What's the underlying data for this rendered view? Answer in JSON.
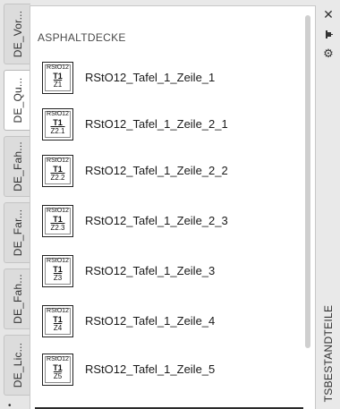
{
  "tabs": [
    {
      "label": "DE_Vor...",
      "active": false
    },
    {
      "label": "DE_Qu...",
      "active": true
    },
    {
      "label": "DE_Fah...",
      "active": false
    },
    {
      "label": "DE_Far...",
      "active": false
    },
    {
      "label": "DE_Fah...",
      "active": false
    },
    {
      "label": "DE_Lic...",
      "active": false
    }
  ],
  "panel": {
    "section_title": "ASPHALTDECKE",
    "items": [
      {
        "sign": {
          "line1": "RStO12",
          "line2": "T1",
          "line3": "Z1"
        },
        "label": "RStO12_Tafel_1_Zeile_1"
      },
      {
        "sign": {
          "line1": "RStO12",
          "line2": "T1",
          "line3": "Z2.1"
        },
        "label": "RStO12_Tafel_1_Zeile_2_1"
      },
      {
        "sign": {
          "line1": "RStO12",
          "line2": "T1",
          "line3": "Z2.2"
        },
        "label": "RStO12_Tafel_1_Zeile_2_2"
      },
      {
        "sign": {
          "line1": "RStO12",
          "line2": "T1",
          "line3": "Z2.3"
        },
        "label": "RStO12_Tafel_1_Zeile_2_3"
      },
      {
        "sign": {
          "line1": "RStO12",
          "line2": "T1",
          "line3": "Z3"
        },
        "label": "RStO12_Tafel_1_Zeile_3"
      },
      {
        "sign": {
          "line1": "RStO12",
          "line2": "T1",
          "line3": "Z4"
        },
        "label": "RStO12_Tafel_1_Zeile_4"
      },
      {
        "sign": {
          "line1": "RStO12",
          "line2": "T1",
          "line3": "Z5"
        },
        "label": "RStO12_Tafel_1_Zeile_5"
      }
    ]
  },
  "right_strip": {
    "close_glyph": "✕",
    "gear_glyph": "⚙",
    "title": "TSBESTANDTEILE",
    "icons": [
      "close-icon",
      "pin-icon",
      "gear-icon"
    ]
  },
  "colors": {
    "panel_bg": "#ffffff",
    "chrome_bg": "#e9e9e9",
    "tab_active": "#ffffff",
    "tab_inactive": "#dcdcdc"
  }
}
